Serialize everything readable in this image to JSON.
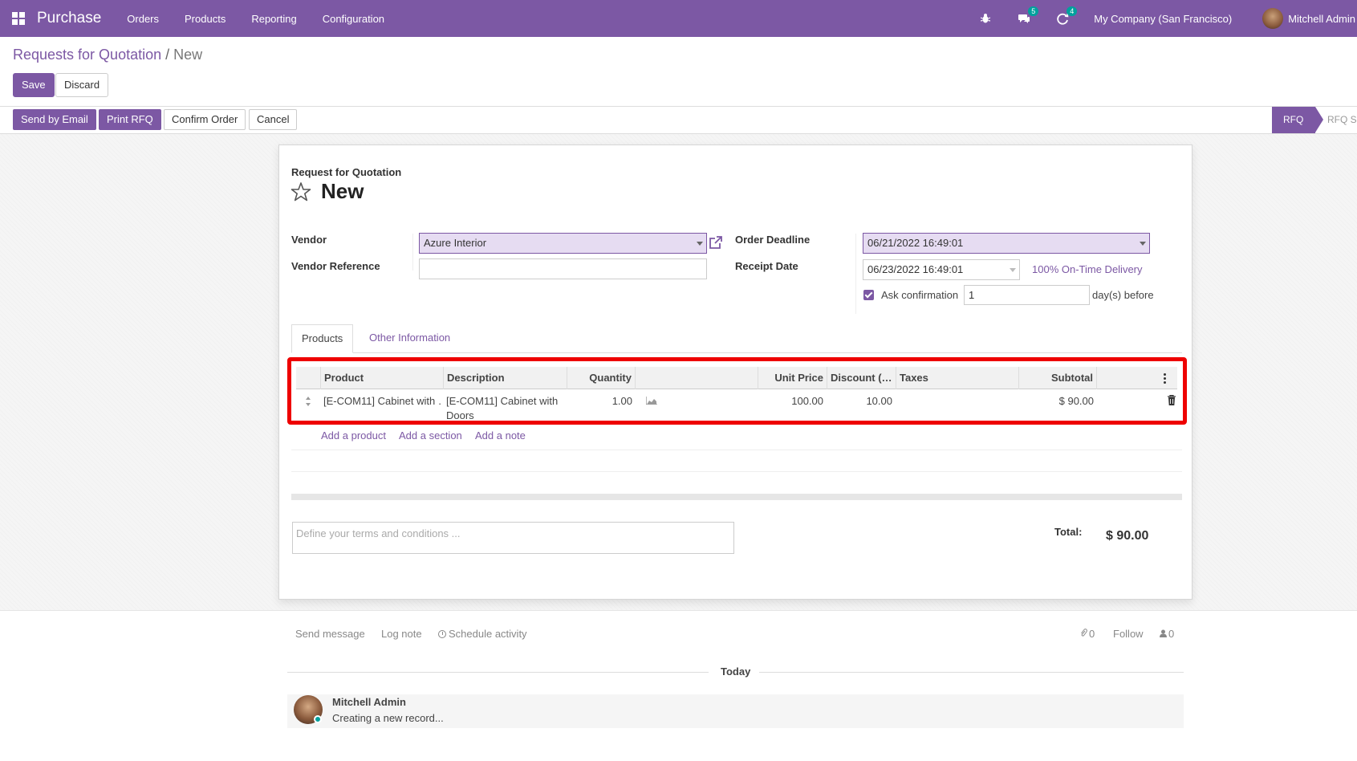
{
  "navbar": {
    "app_name": "Purchase",
    "menus": [
      "Orders",
      "Products",
      "Reporting",
      "Configuration"
    ],
    "messages_count": "5",
    "activities_count": "4",
    "company": "My Company (San Francisco)",
    "user": "Mitchell Admin",
    "icons": [
      "apps-grid-icon",
      "bug-icon",
      "chat-icon",
      "activity-clock-icon"
    ]
  },
  "breadcrumb": {
    "parent": "Requests for Quotation",
    "separator": "/",
    "current": "New"
  },
  "control": {
    "save": "Save",
    "discard": "Discard"
  },
  "status_actions": {
    "send_email": "Send by Email",
    "print": "Print RFQ",
    "confirm": "Confirm Order",
    "cancel": "Cancel"
  },
  "stages": {
    "active": "RFQ",
    "next": "RFQ Sent"
  },
  "form": {
    "doc_type": "Request for Quotation",
    "title": "New",
    "vendor_label": "Vendor",
    "vendor_value": "Azure Interior",
    "vendor_ref_label": "Vendor Reference",
    "vendor_ref_value": "",
    "order_deadline_label": "Order Deadline",
    "order_deadline_value": "06/21/2022 16:49:01",
    "receipt_date_label": "Receipt Date",
    "receipt_date_value": "06/23/2022 16:49:01",
    "on_time_link": "100% On-Time Delivery",
    "ask_confirmation_label": "Ask confirmation",
    "ask_confirmation_checked": true,
    "ask_days_value": "1",
    "days_before": "day(s) before"
  },
  "tabs": {
    "products": "Products",
    "other": "Other Information"
  },
  "table": {
    "headers": {
      "product": "Product",
      "description": "Description",
      "quantity": "Quantity",
      "unit_price": "Unit Price",
      "discount": "Discount (…",
      "taxes": "Taxes",
      "subtotal": "Subtotal"
    },
    "rows": [
      {
        "product": "[E-COM11] Cabinet with …",
        "description_line1": "[E-COM11] Cabinet with",
        "description_line2": "Doors",
        "quantity": "1.00",
        "unit_price": "100.00",
        "discount": "10.00",
        "taxes": "",
        "subtotal": "$ 90.00"
      }
    ],
    "add_product": "Add a product",
    "add_section": "Add a section",
    "add_note": "Add a note"
  },
  "footer": {
    "terms_placeholder": "Define your terms and conditions ...",
    "total_label": "Total:",
    "total_value": "$ 90.00"
  },
  "chatter": {
    "send_message": "Send message",
    "log_note": "Log note",
    "schedule_activity": "Schedule activity",
    "attachments_count": "0",
    "follow": "Follow",
    "followers_count": "0",
    "day_separator": "Today",
    "messages": [
      {
        "author": "Mitchell Admin",
        "body": "Creating a new record..."
      }
    ]
  },
  "colors": {
    "brand": "#7c58a4",
    "highlight": "#e6dcf2",
    "annotation_red": "#e00000",
    "badge": "#00a09d"
  }
}
